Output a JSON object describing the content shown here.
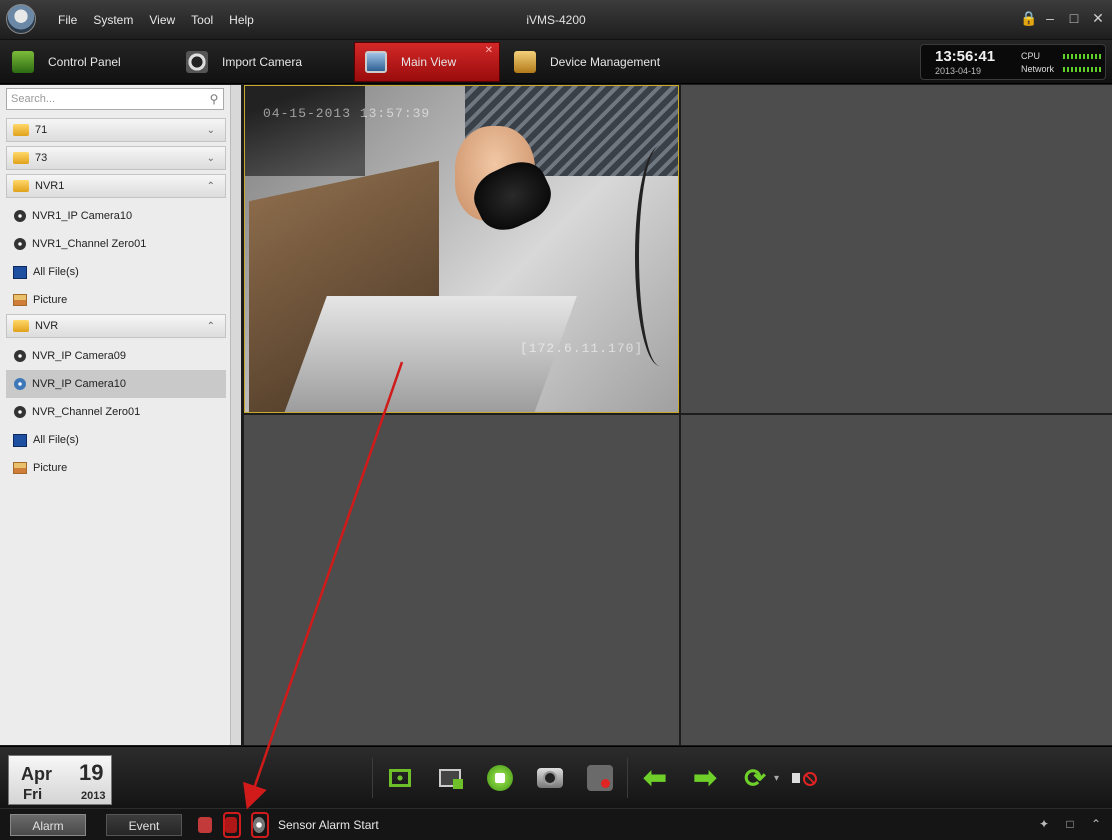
{
  "app": {
    "title": "iVMS-4200"
  },
  "menu": {
    "items": [
      "File",
      "System",
      "View",
      "Tool",
      "Help"
    ]
  },
  "window_controls": [
    "lock-icon",
    "minimize-icon",
    "maximize-icon",
    "close-icon"
  ],
  "tabs": [
    {
      "label": "Control Panel",
      "icon": "control-panel-icon",
      "active": false
    },
    {
      "label": "Import Camera",
      "icon": "camera-icon",
      "active": false
    },
    {
      "label": "Main View",
      "icon": "main-view-icon",
      "active": true
    },
    {
      "label": "Device Management",
      "icon": "device-icon",
      "active": false
    }
  ],
  "status_box": {
    "time": "13:56:41",
    "date": "2013-04-19",
    "cpu_label": "CPU",
    "network_label": "Network"
  },
  "sidebar": {
    "search": {
      "placeholder": "Search..."
    },
    "tree": [
      {
        "type": "group",
        "label": "71",
        "expanded": false
      },
      {
        "type": "group",
        "label": "73",
        "expanded": false
      },
      {
        "type": "group",
        "label": "NVR1",
        "expanded": true
      },
      {
        "type": "camera",
        "label": "NVR1_IP Camera10"
      },
      {
        "type": "camera",
        "label": "NVR1_Channel Zero01"
      },
      {
        "type": "files",
        "label": "All File(s)"
      },
      {
        "type": "picture",
        "label": "Picture"
      },
      {
        "type": "group",
        "label": "NVR",
        "expanded": true
      },
      {
        "type": "camera",
        "label": "NVR_IP Camera09"
      },
      {
        "type": "camera",
        "label": "NVR_IP Camera10",
        "selected": true
      },
      {
        "type": "camera",
        "label": "NVR_Channel Zero01"
      },
      {
        "type": "files",
        "label": "All File(s)"
      },
      {
        "type": "picture",
        "label": "Picture"
      }
    ]
  },
  "video": {
    "osd_date": "04-15-2013 13:57:39",
    "osd_ip": "[172.6.11.170]"
  },
  "date_tile": {
    "month": "Apr",
    "day": "19",
    "weekday": "Fri",
    "year": "2013"
  },
  "toolbar": {
    "buttons": [
      "fullscreen-icon",
      "window-split-icon",
      "stop-all-icon",
      "capture-icon",
      "record-icon",
      "previous-icon",
      "next-icon",
      "cycle-icon",
      "mute-icon"
    ]
  },
  "statusbar": {
    "tabs": [
      {
        "label": "Alarm",
        "active": true
      },
      {
        "label": "Event",
        "active": false
      }
    ],
    "message": "Sensor Alarm  Start"
  },
  "colors": {
    "accent_red": "#c21a1a",
    "green": "#6fbf2b",
    "selection_border": "#c9a82b"
  }
}
